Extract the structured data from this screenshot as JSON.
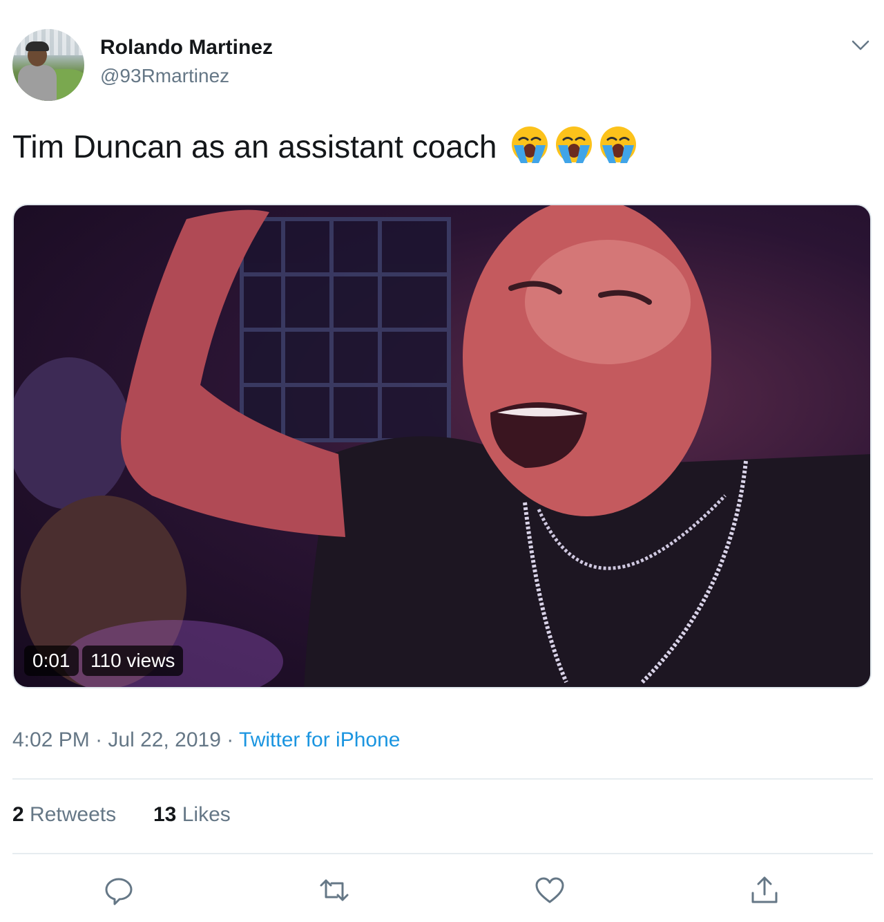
{
  "author": {
    "name": "Rolando Martinez",
    "handle": "@93Rmartinez"
  },
  "tweet": {
    "text": "Tim Duncan as an assistant coach",
    "emojis": [
      "loudly-crying-face",
      "loudly-crying-face",
      "loudly-crying-face"
    ]
  },
  "media": {
    "duration": "0:01",
    "views": "110 views"
  },
  "meta": {
    "time": "4:02 PM",
    "separator": "·",
    "date": "Jul 22, 2019",
    "source": "Twitter for iPhone"
  },
  "stats": {
    "retweets_count": "2",
    "retweets_label": "Retweets",
    "likes_count": "13",
    "likes_label": "Likes"
  },
  "actions": [
    "reply-icon",
    "retweet-icon",
    "like-icon",
    "share-icon"
  ],
  "colors": {
    "text": "#14171a",
    "secondary": "#657786",
    "link": "#1b95e0",
    "divider": "#e6ecf0"
  }
}
